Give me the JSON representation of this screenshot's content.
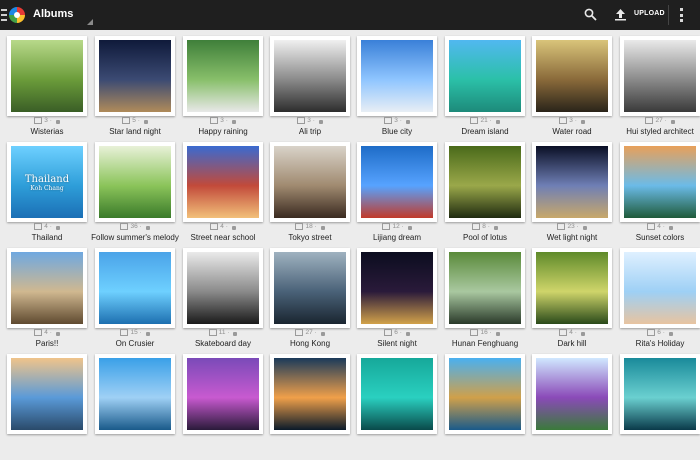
{
  "actionbar": {
    "title": "Albums",
    "upload_label": "UPLOAD"
  },
  "albums": [
    {
      "name": "Wisterias",
      "count": "3",
      "colors": [
        "#b8d98a",
        "#6b9c3a",
        "#3a5e26"
      ]
    },
    {
      "name": "Star land night",
      "count": "5",
      "colors": [
        "#0f1a3a",
        "#3b4a73",
        "#b08b5a"
      ]
    },
    {
      "name": "Happy raining",
      "count": "3",
      "colors": [
        "#3f7f3a",
        "#88bf6a",
        "#e8e8e8"
      ]
    },
    {
      "name": "Ali trip",
      "count": "3",
      "colors": [
        "#f0f0f0",
        "#8a8a8a",
        "#2d2d2d"
      ]
    },
    {
      "name": "Blue city",
      "count": "3",
      "colors": [
        "#3a80d8",
        "#8fc5ff",
        "#e8eef5"
      ]
    },
    {
      "name": "Dream island",
      "count": "21",
      "colors": [
        "#51b8f0",
        "#2bc0a8",
        "#1d8a7a"
      ]
    },
    {
      "name": "Water road",
      "count": "3",
      "colors": [
        "#d9c47a",
        "#8a6a3a",
        "#2a241a"
      ]
    },
    {
      "name": "Hui styled architect",
      "count": "27",
      "colors": [
        "#e9e9e9",
        "#8a8a8a",
        "#3a3a3a"
      ]
    },
    {
      "name": "Thailand",
      "count": "4",
      "colors": [
        "#6ed0ff",
        "#2e9ed9",
        "#1b6fb5"
      ],
      "caption": "Thailand",
      "caption_sub": "Koh Chang"
    },
    {
      "name": "Follow summer's melody",
      "count": "36",
      "colors": [
        "#e8f1d8",
        "#8bc45a",
        "#3a7a2a"
      ]
    },
    {
      "name": "Street near school",
      "count": "4",
      "colors": [
        "#3a6ad0",
        "#c24a3a",
        "#f2c07a"
      ]
    },
    {
      "name": "Tokyo street",
      "count": "18",
      "colors": [
        "#d9d3c9",
        "#a08a70",
        "#3a2a20"
      ]
    },
    {
      "name": "Lijiang dream",
      "count": "12",
      "colors": [
        "#1e6cc7",
        "#57a3ff",
        "#c23a2a"
      ]
    },
    {
      "name": "Pool of lotus",
      "count": "8",
      "colors": [
        "#4a6a1a",
        "#9aa84a",
        "#1f2a10"
      ]
    },
    {
      "name": "Wet light night",
      "count": "23",
      "colors": [
        "#0a0f25",
        "#6f7fb5",
        "#c8a86a"
      ]
    },
    {
      "name": "Sunset colors",
      "count": "4",
      "colors": [
        "#e8a05a",
        "#6bbbe8",
        "#1f5a3a"
      ]
    },
    {
      "name": "Paris!!",
      "count": "4",
      "colors": [
        "#6fa8e0",
        "#d0b890",
        "#5f4a30"
      ]
    },
    {
      "name": "On Crusier",
      "count": "15",
      "colors": [
        "#4aa3e8",
        "#6ed0ff",
        "#1d6fb0"
      ]
    },
    {
      "name": "Skateboard day",
      "count": "11",
      "colors": [
        "#eaeaea",
        "#8a8a8a",
        "#1a1a1a"
      ]
    },
    {
      "name": "Hong Kong",
      "count": "27",
      "colors": [
        "#9fb2c0",
        "#4a6278",
        "#1a2530"
      ]
    },
    {
      "name": "Silent night",
      "count": "6",
      "colors": [
        "#0b0d1f",
        "#2a1a3a",
        "#d2a24a"
      ]
    },
    {
      "name": "Hunan Fenghuang",
      "count": "16",
      "colors": [
        "#5a8a3a",
        "#a9c8a0",
        "#2a3a2a"
      ]
    },
    {
      "name": "Dark hill",
      "count": "4",
      "colors": [
        "#5f8a2a",
        "#cfd56a",
        "#2a4a1a"
      ]
    },
    {
      "name": "Rita's Holiday",
      "count": "6",
      "colors": [
        "#dff0ff",
        "#9ed0f5",
        "#e8c4a0"
      ]
    },
    {
      "name": "",
      "count": "",
      "colors": [
        "#f0c48a",
        "#5a9ad8",
        "#2a4a6a"
      ]
    },
    {
      "name": "",
      "count": "",
      "colors": [
        "#3aa0e8",
        "#9fd0f5",
        "#1a5a8a"
      ]
    },
    {
      "name": "",
      "count": "",
      "colors": [
        "#7a4ab8",
        "#c85ad0",
        "#2a1a3a"
      ]
    },
    {
      "name": "",
      "count": "",
      "colors": [
        "#1a3a5a",
        "#f0a04a",
        "#0a1a2a"
      ]
    },
    {
      "name": "",
      "count": "",
      "colors": [
        "#16a89a",
        "#2ad0c0",
        "#0a4a4a"
      ]
    },
    {
      "name": "",
      "count": "",
      "colors": [
        "#4ab0f0",
        "#d0a04a",
        "#1a5a8a"
      ]
    },
    {
      "name": "",
      "count": "",
      "colors": [
        "#d0e8ff",
        "#8a4ab8",
        "#3a7a3a"
      ]
    },
    {
      "name": "",
      "count": "",
      "colors": [
        "#1a8a9a",
        "#6ad0d0",
        "#0a3a4a"
      ]
    }
  ]
}
